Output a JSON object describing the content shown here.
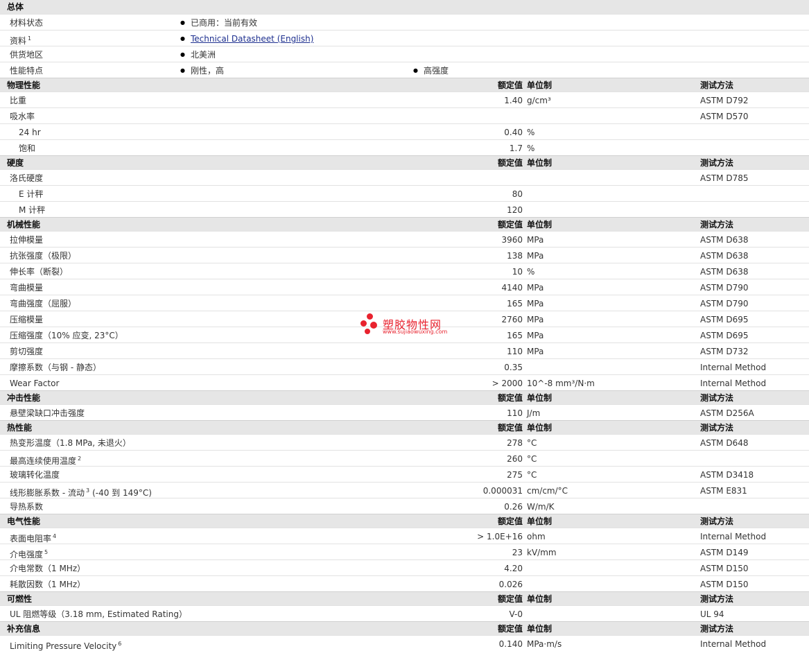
{
  "general": {
    "title": "总体",
    "material_status_label": "材料状态",
    "material_status_value": "已商用：当前有效",
    "docs_label": "资料",
    "docs_sup": "1",
    "docs_link": "Technical Datasheet (English)",
    "region_label": "供货地区",
    "region_value": "北美洲",
    "features_label": "性能特点",
    "features_value1": "刚性，高",
    "features_value2": "高强度"
  },
  "col_headers": {
    "value": "额定值",
    "unit": "单位制",
    "method": "测试方法"
  },
  "sections": {
    "physical": {
      "title": "物理性能",
      "rows": [
        {
          "label": "比重",
          "value": "1.40",
          "unit": "g/cm³",
          "method": "ASTM D792"
        },
        {
          "label": "吸水率",
          "value": "",
          "unit": "",
          "method": "ASTM D570"
        },
        {
          "label": "24 hr",
          "value": "0.40",
          "unit": "%",
          "method": ""
        },
        {
          "label": "饱和",
          "value": "1.7",
          "unit": "%",
          "method": ""
        }
      ]
    },
    "hardness": {
      "title": "硬度",
      "rows": [
        {
          "label": "洛氏硬度",
          "value": "",
          "unit": "",
          "method": "ASTM D785"
        },
        {
          "label": "E 计秤",
          "value": "80",
          "unit": "",
          "method": ""
        },
        {
          "label": "M 计秤",
          "value": "120",
          "unit": "",
          "method": ""
        }
      ]
    },
    "mechanical": {
      "title": "机械性能",
      "rows": [
        {
          "label": "拉伸模量",
          "value": "3960",
          "unit": "MPa",
          "method": "ASTM D638"
        },
        {
          "label": "抗张强度（极限）",
          "value": "138",
          "unit": "MPa",
          "method": "ASTM D638"
        },
        {
          "label": "伸长率（断裂）",
          "value": "10",
          "unit": "%",
          "method": "ASTM D638"
        },
        {
          "label": "弯曲模量",
          "value": "4140",
          "unit": "MPa",
          "method": "ASTM D790"
        },
        {
          "label": "弯曲强度（屈服）",
          "value": "165",
          "unit": "MPa",
          "method": "ASTM D790"
        },
        {
          "label": "压缩模量",
          "value": "2760",
          "unit": "MPa",
          "method": "ASTM D695"
        },
        {
          "label": "压缩强度（10% 应变, 23°C）",
          "value": "165",
          "unit": "MPa",
          "method": "ASTM D695"
        },
        {
          "label": "剪切强度",
          "value": "110",
          "unit": "MPa",
          "method": "ASTM D732"
        },
        {
          "label": "摩擦系数（与钢 - 静态）",
          "value": "0.35",
          "unit": "",
          "method": "Internal Method"
        },
        {
          "label": "Wear Factor",
          "value": "> 2000",
          "unit": "10^-8 mm³/N·m",
          "method": "Internal Method"
        }
      ]
    },
    "impact": {
      "title": "冲击性能",
      "rows": [
        {
          "label": "悬壁梁缺口冲击强度",
          "value": "110",
          "unit": "J/m",
          "method": "ASTM D256A"
        }
      ]
    },
    "thermal": {
      "title": "热性能",
      "rows": [
        {
          "label": "热变形温度（1.8 MPa, 未退火）",
          "value": "278",
          "unit": "°C",
          "method": "ASTM D648"
        },
        {
          "label": "最高连续使用温度",
          "sup": "2",
          "value": "260",
          "unit": "°C",
          "method": ""
        },
        {
          "label": "玻璃转化温度",
          "value": "275",
          "unit": "°C",
          "method": "ASTM D3418"
        },
        {
          "label": "线形膨胀系数 - 流动",
          "sup": "3",
          "suffix": "(-40 到 149°C)",
          "value": "0.000031",
          "unit": "cm/cm/°C",
          "method": "ASTM E831"
        },
        {
          "label": "导热系数",
          "value": "0.26",
          "unit": "W/m/K",
          "method": ""
        }
      ]
    },
    "electrical": {
      "title": "电气性能",
      "rows": [
        {
          "label": "表面电阻率",
          "sup": "4",
          "value": "> 1.0E+16",
          "unit": "ohm",
          "method": "Internal Method"
        },
        {
          "label": "介电强度",
          "sup": "5",
          "value": "23",
          "unit": "kV/mm",
          "method": "ASTM D149"
        },
        {
          "label": "介电常数（1 MHz）",
          "value": "4.20",
          "unit": "",
          "method": "ASTM D150"
        },
        {
          "label": "耗散因数（1 MHz）",
          "value": "0.026",
          "unit": "",
          "method": "ASTM D150"
        }
      ]
    },
    "flammability": {
      "title": "可燃性",
      "rows": [
        {
          "label": "UL 阻燃等级（3.18 mm, Estimated Rating）",
          "value": "V-0",
          "unit": "",
          "method": "UL 94"
        }
      ]
    },
    "additional": {
      "title": "补充信息",
      "rows": [
        {
          "label": "Limiting Pressure Velocity",
          "sup": "6",
          "value": "0.140",
          "unit": "MPa·m/s",
          "method": "Internal Method"
        }
      ]
    }
  },
  "watermark": {
    "text": "塑胶物性网",
    "url": "www.sujiaowuxing.com",
    "color": "#e8222e"
  }
}
